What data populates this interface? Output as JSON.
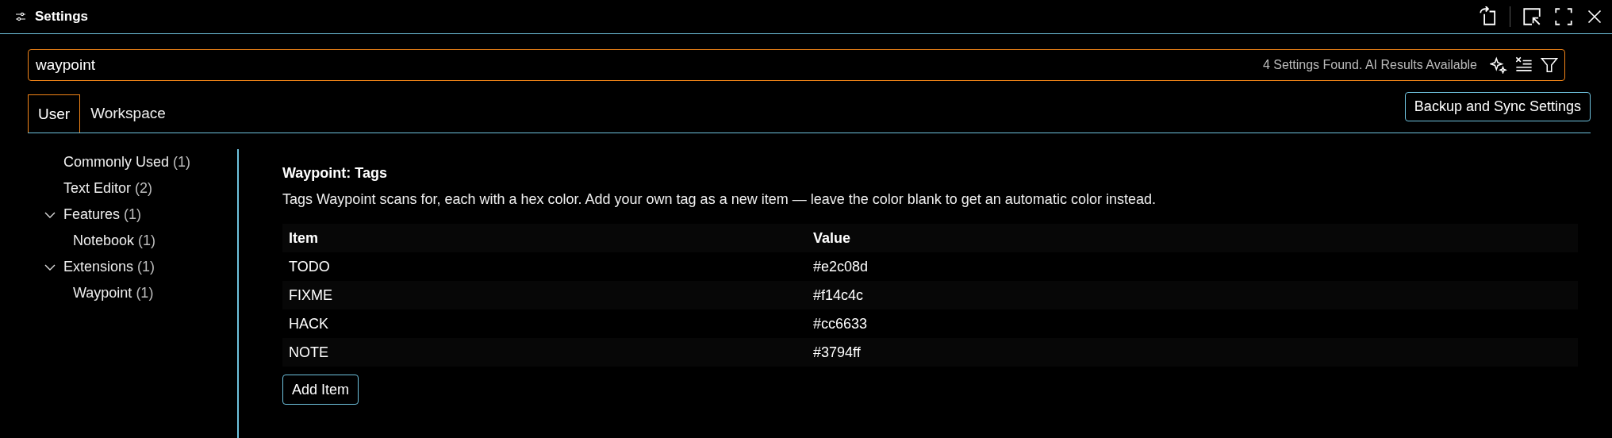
{
  "window": {
    "title": "Settings"
  },
  "search": {
    "value": "waypoint",
    "result_text": "4 Settings Found. AI Results Available"
  },
  "tabs": [
    {
      "label": "User",
      "selected": true
    },
    {
      "label": "Workspace",
      "selected": false
    }
  ],
  "sync_button": "Backup and Sync Settings",
  "sidebar": {
    "items": [
      {
        "label": "Commonly Used",
        "count": "(1)"
      },
      {
        "label": "Text Editor",
        "count": "(2)"
      },
      {
        "label": "Features",
        "count": "(1)",
        "expanded": true,
        "children": [
          {
            "label": "Notebook",
            "count": "(1)"
          }
        ]
      },
      {
        "label": "Extensions",
        "count": "(1)",
        "expanded": true,
        "children": [
          {
            "label": "Waypoint",
            "count": "(1)"
          }
        ]
      }
    ]
  },
  "setting": {
    "title": "Waypoint: Tags",
    "description": "Tags Waypoint scans for, each with a hex color. Add your own tag as a new item — leave the color blank to get an automatic color instead.",
    "table": {
      "columns": [
        "Item",
        "Value"
      ],
      "rows": [
        [
          "TODO",
          "#e2c08d"
        ],
        [
          "FIXME",
          "#f14c4c"
        ],
        [
          "HACK",
          "#cc6633"
        ],
        [
          "NOTE",
          "#3794ff"
        ]
      ]
    },
    "add_button": "Add Item"
  }
}
